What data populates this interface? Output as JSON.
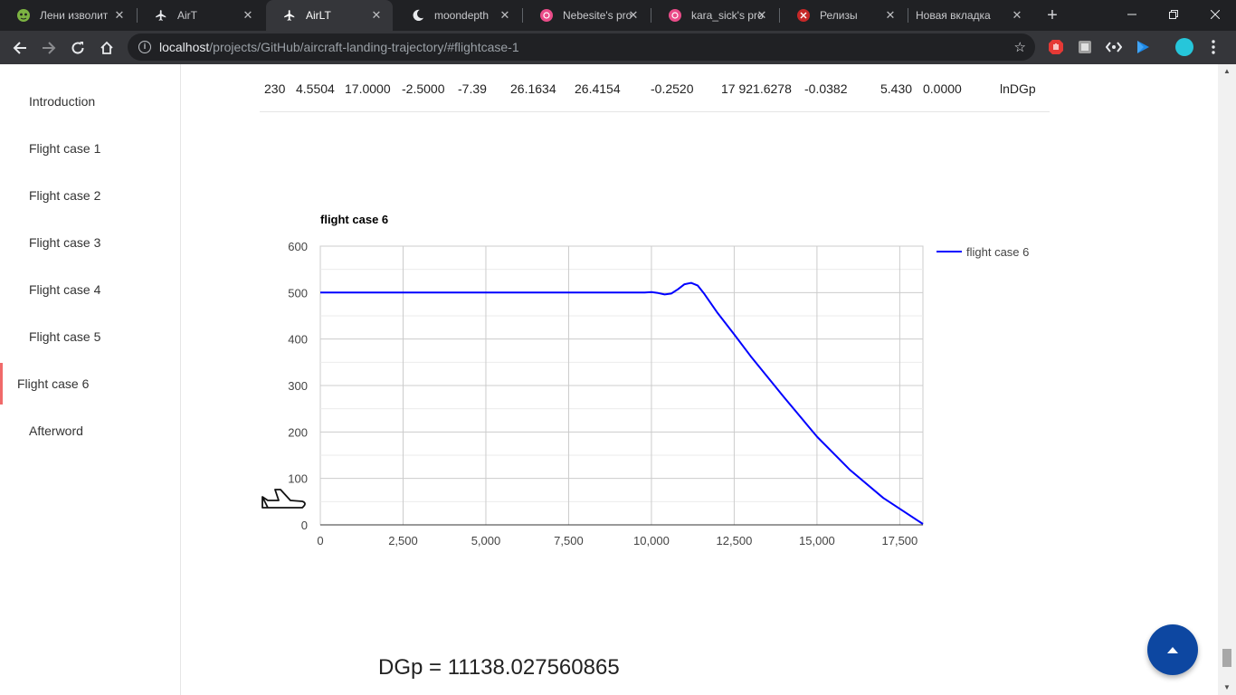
{
  "browser": {
    "tabs": [
      {
        "title": "Лени изволит",
        "icon": "cat-icon"
      },
      {
        "title": "AirT",
        "icon": "airplane-icon"
      },
      {
        "title": "AirLT",
        "icon": "airplane-icon"
      },
      {
        "title": "moondepth",
        "icon": "moon-icon"
      },
      {
        "title": "Nebesite's pro",
        "icon": "pink-circle-icon"
      },
      {
        "title": "kara_sick's pro",
        "icon": "pink-circle-icon"
      },
      {
        "title": "Релизы",
        "icon": "red-badge-icon"
      },
      {
        "title": "Новая вкладка",
        "icon": ""
      }
    ],
    "active_tab": 2,
    "url_host": "localhost",
    "url_path": "/projects/GitHub/aircraft-landing-trajectory/#flightcase-1"
  },
  "sidebar": {
    "items": [
      {
        "label": "Introduction"
      },
      {
        "label": "Flight case 1"
      },
      {
        "label": "Flight case 2"
      },
      {
        "label": "Flight case 3"
      },
      {
        "label": "Flight case 4"
      },
      {
        "label": "Flight case 5"
      },
      {
        "label": "Flight case 6"
      },
      {
        "label": "Afterword"
      }
    ],
    "active_index": 6
  },
  "table_row": {
    "cells": [
      "230",
      "4.5504",
      "17.0000",
      "-2.5000",
      "-7.39",
      "26.1634",
      "26.4154",
      "-0.2520",
      "17 921.6278",
      "-0.0382",
      "5.430",
      "0.0000",
      "lnDGp"
    ]
  },
  "chart_data": {
    "type": "line",
    "title": "flight case 6",
    "xlabel": "",
    "ylabel": "",
    "xlim": [
      0,
      18200
    ],
    "ylim": [
      0,
      600
    ],
    "xticks": [
      "0",
      "2,500",
      "5,000",
      "7,500",
      "10,000",
      "12,500",
      "15,000",
      "17,500"
    ],
    "xtick_values": [
      0,
      2500,
      5000,
      7500,
      10000,
      12500,
      15000,
      17500
    ],
    "yticks": [
      "0",
      "100",
      "200",
      "300",
      "400",
      "500",
      "600"
    ],
    "ytick_values": [
      0,
      100,
      200,
      300,
      400,
      500,
      600
    ],
    "grid": true,
    "legend_position": "right",
    "series": [
      {
        "name": "flight case 6",
        "color": "#0000ff",
        "x": [
          0,
          2500,
          5000,
          7500,
          9800,
          10000,
          10200,
          10400,
          10600,
          10800,
          11000,
          11200,
          11400,
          11600,
          12000,
          12500,
          13000,
          14000,
          15000,
          16000,
          17000,
          18200
        ],
        "y": [
          500,
          500,
          500,
          500,
          500,
          501,
          499,
          496,
          498,
          507,
          518,
          521,
          515,
          497,
          456,
          410,
          363,
          275,
          190,
          118,
          58,
          2
        ]
      }
    ]
  },
  "result": {
    "text": "DGp = 11138.027560865"
  },
  "colors": {
    "accent": "#f06a6a",
    "fab": "#0d47a1",
    "series": "#0000ff"
  }
}
